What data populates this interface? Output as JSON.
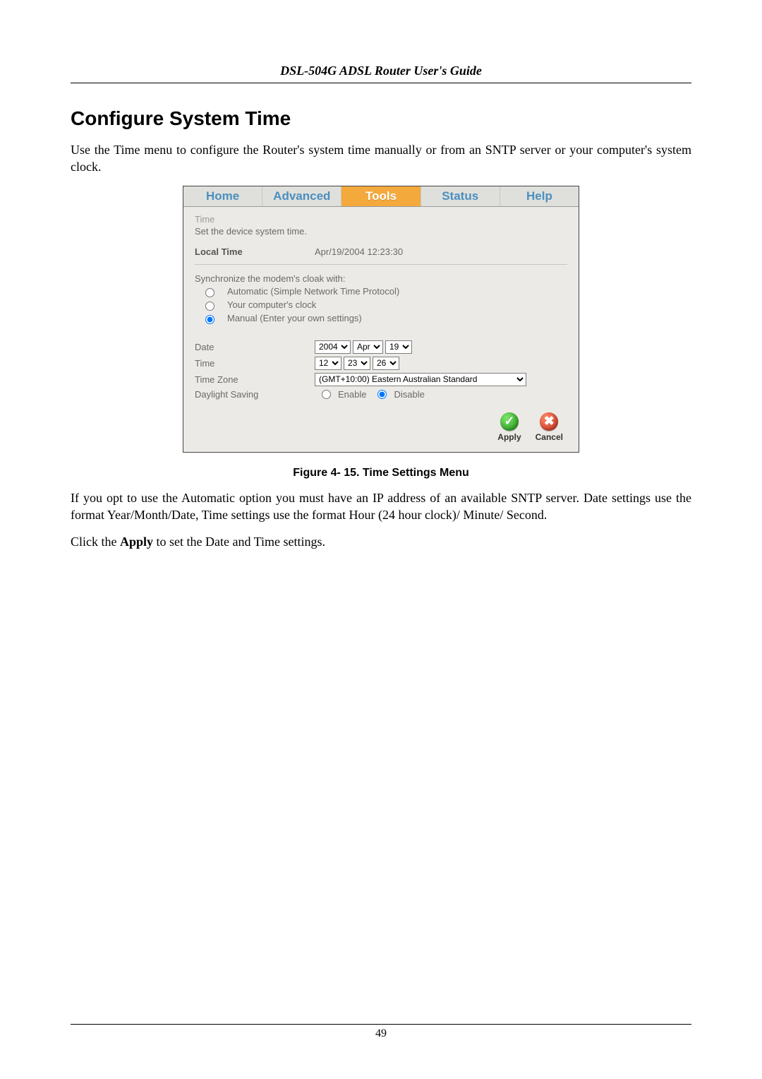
{
  "doc": {
    "running_head": "DSL-504G ADSL Router User's Guide",
    "section_title": "Configure System Time",
    "intro": "Use the Time menu to configure the Router's system time manually or from an SNTP server or your computer's system clock.",
    "figure_caption": "Figure 4- 15. Time Settings Menu",
    "para_after_1": "If you opt to use the Automatic option you must have an IP address of an available SNTP server. Date settings use the format Year/Month/Date, Time settings use the format Hour (24 hour clock)/ Minute/ Second.",
    "para_after_2_prefix": "Click the ",
    "para_after_2_bold": "Apply",
    "para_after_2_suffix": " to set the Date and Time settings.",
    "page_number": "49"
  },
  "ui": {
    "tabs": {
      "home": "Home",
      "advanced": "Advanced",
      "tools": "Tools",
      "status": "Status",
      "help": "Help"
    },
    "heading": "Time",
    "subhead": "Set the device system time.",
    "local_time_label": "Local Time",
    "local_time_value": "Apr/19/2004  12:23:30",
    "sync_label": "Synchronize the modem's cloak with:",
    "sync_opts": {
      "auto": "Automatic (Simple Network Time Protocol)",
      "pc": "Your computer's clock",
      "manual": "Manual (Enter your own settings)"
    },
    "date_label": "Date",
    "date": {
      "year": "2004",
      "month": "Apr",
      "day": "19"
    },
    "time_label": "Time",
    "time": {
      "h": "12",
      "m": "23",
      "s": "26"
    },
    "tz_label": "Time Zone",
    "tz_value": "(GMT+10:00) Eastern Australian Standard",
    "ds_label": "Daylight Saving",
    "ds": {
      "enable": "Enable",
      "disable": "Disable"
    },
    "buttons": {
      "apply": "Apply",
      "cancel": "Cancel"
    }
  }
}
